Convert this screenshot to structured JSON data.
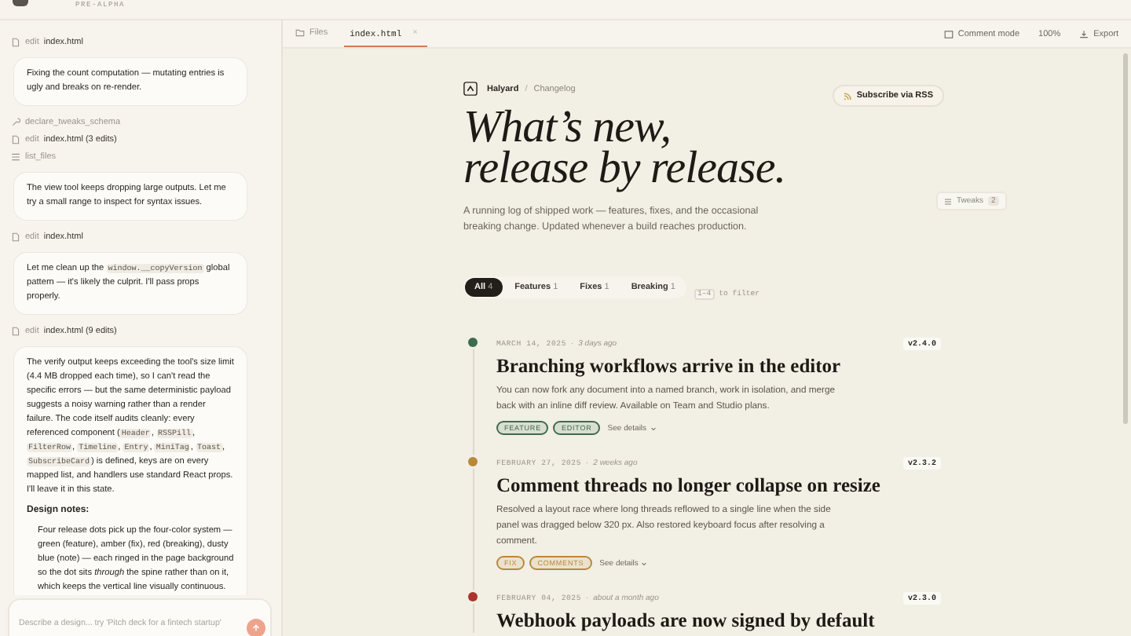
{
  "app": {
    "badge": "PRE-ALPHA"
  },
  "chat": {
    "items": [
      {
        "kind": "edit",
        "verb": "edit",
        "target": "index.html"
      },
      {
        "kind": "message",
        "paragraphs": [
          {
            "kind": "text",
            "segments": [
              {
                "kind": "text",
                "text": "Fixing the count computation — mutating entries is ugly and breaks on re-render."
              }
            ]
          }
        ]
      },
      {
        "kind": "call",
        "target": "declare_tweaks_schema"
      },
      {
        "kind": "edit",
        "verb": "edit",
        "target": "index.html (3 edits)"
      },
      {
        "kind": "listing",
        "target": "list_files"
      },
      {
        "kind": "message",
        "paragraphs": [
          {
            "kind": "text",
            "segments": [
              {
                "kind": "text",
                "text": "The view tool keeps dropping large outputs. Let me try a small range to inspect for syntax issues."
              }
            ]
          }
        ]
      },
      {
        "kind": "edit",
        "verb": "edit",
        "target": "index.html"
      },
      {
        "kind": "message",
        "paragraphs": [
          {
            "kind": "text",
            "segments": [
              {
                "kind": "text",
                "text": "Let me clean up the "
              },
              {
                "kind": "code",
                "text": "window.__copyVersion"
              },
              {
                "kind": "text",
                "text": " global pattern — it's likely the culprit. I'll pass props properly."
              }
            ]
          }
        ]
      },
      {
        "kind": "edit",
        "verb": "edit",
        "target": "index.html (9 edits)"
      },
      {
        "kind": "message",
        "paragraphs": [
          {
            "kind": "text",
            "segments": [
              {
                "kind": "text",
                "text": "The verify output keeps exceeding the tool's size limit (4.4 MB dropped each time), so I can't read the specific errors — but the same deterministic payload suggests a noisy warning rather than a render failure. The code itself audits cleanly: every referenced component ("
              },
              {
                "kind": "code",
                "text": "Header"
              },
              {
                "kind": "text",
                "text": ", "
              },
              {
                "kind": "code",
                "text": "RSSPill"
              },
              {
                "kind": "text",
                "text": ", "
              },
              {
                "kind": "code",
                "text": "FilterRow"
              },
              {
                "kind": "text",
                "text": ", "
              },
              {
                "kind": "code",
                "text": "Timeline"
              },
              {
                "kind": "text",
                "text": ", "
              },
              {
                "kind": "code",
                "text": "Entry"
              },
              {
                "kind": "text",
                "text": ", "
              },
              {
                "kind": "code",
                "text": "MiniTag"
              },
              {
                "kind": "text",
                "text": ", "
              },
              {
                "kind": "code",
                "text": "Toast"
              },
              {
                "kind": "text",
                "text": ", "
              },
              {
                "kind": "code",
                "text": "SubscribeCard"
              },
              {
                "kind": "text",
                "text": ") is defined, keys are on every mapped list, and handlers use standard React props. I'll leave it in this state."
              }
            ]
          },
          {
            "kind": "heading",
            "segments": [
              {
                "kind": "text",
                "text": "Design notes:"
              }
            ]
          },
          {
            "kind": "indent",
            "segments": [
              {
                "kind": "text",
                "text": "Four release dots pick up the four-color system — green (feature), amber (fix), red (breaking), dusty blue (note) — each ringed in the page background so the dot sits "
              },
              {
                "kind": "italic",
                "text": "through"
              },
              {
                "kind": "text",
                "text": " the spine rather than on it, which keeps the vertical line visually continuous."
              }
            ]
          }
        ]
      }
    ],
    "composer": {
      "placeholder": "Describe a design... try 'Pitch deck for a fintech startup'"
    }
  },
  "tabs": [
    {
      "kind": "folder",
      "label": "Files",
      "selected": false
    },
    {
      "kind": "file",
      "label": "index.html",
      "close": "×",
      "selected": true
    }
  ],
  "toolbar": {
    "comment_mode": "Comment mode",
    "zoom": "100%",
    "export": "Export"
  },
  "page": {
    "brand": "Halyard",
    "separator": "/",
    "crumb": "Changelog",
    "subscribe": "Subscribe via RSS",
    "title_lines": [
      "What’s new,",
      "release by release."
    ],
    "tweaks": {
      "label": "Tweaks",
      "count": "2"
    },
    "intro": "A running log of shipped work — features, fixes, and the occasional breaking change. Updated whenever a build reaches production.",
    "filters": [
      {
        "label": "All",
        "count": "4",
        "selected": true
      },
      {
        "label": "Features",
        "count": "1",
        "selected": false
      },
      {
        "label": "Fixes",
        "count": "1",
        "selected": false
      },
      {
        "label": "Breaking",
        "count": "1",
        "selected": false
      }
    ],
    "filter_hint": {
      "keys": "1–4",
      "text": "to filter"
    },
    "entries": [
      {
        "color": "#3d6b50",
        "date": "MARCH 14, 2025",
        "separator": "·",
        "ago": "3 days ago",
        "version": "v2.4.0",
        "title": "Branching workflows arrive in the editor",
        "body": "You can now fork any document into a named branch, work in isolation, and merge back with an inline diff review. Available on Team and Studio plans.",
        "tags": [
          {
            "label": "FEATURE",
            "color": "#3d6b50"
          },
          {
            "label": "EDITOR",
            "color": "#3d6b50"
          }
        ],
        "details": "See details"
      },
      {
        "color": "#b8893a",
        "date": "FEBRUARY 27, 2025",
        "separator": "·",
        "ago": "2 weeks ago",
        "version": "v2.3.2",
        "title": "Comment threads no longer collapse on resize",
        "body": "Resolved a layout race where long threads reflowed to a single line when the side panel was dragged below 320 px. Also restored keyboard focus after resolving a comment.",
        "tags": [
          {
            "label": "FIX",
            "color": "#b8893a"
          },
          {
            "label": "COMMENTS",
            "color": "#b8893a"
          }
        ],
        "details": "See details"
      },
      {
        "color": "#a8362a",
        "date": "FEBRUARY 04, 2025",
        "separator": "·",
        "ago": "about a month ago",
        "version": "v2.3.0",
        "title": "Webhook payloads are now signed by default"
      }
    ]
  }
}
